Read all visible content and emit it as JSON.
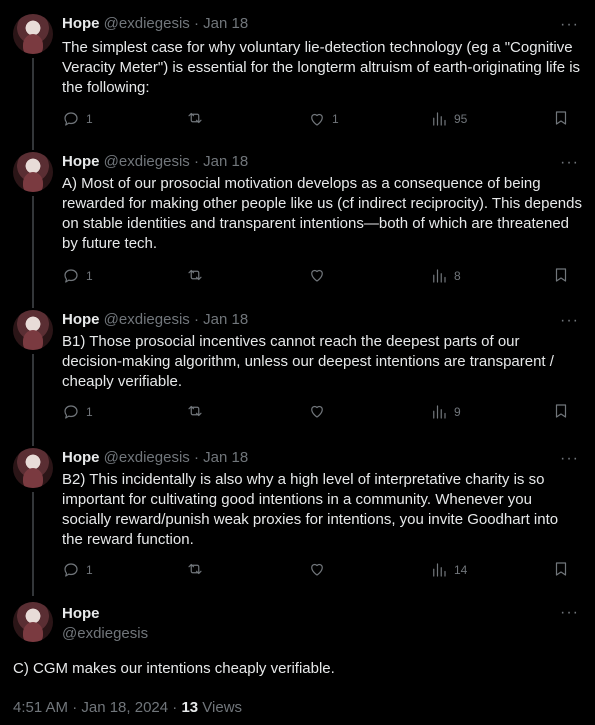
{
  "author": {
    "name": "Hope",
    "handle": "@exdiegesis"
  },
  "more_label": "···",
  "tweets": [
    {
      "date": "Jan 18",
      "text": "The simplest case for why voluntary lie-detection technology (eg a \"Cognitive Veracity Meter\") is essential for the longterm altruism of earth-originating life is the following:",
      "replies": "1",
      "retweets": "",
      "likes": "1",
      "views": "95"
    },
    {
      "date": "Jan 18",
      "text": "A) Most of our prosocial motivation develops as a consequence of being rewarded for making other people like us (cf indirect reciprocity). This depends on stable identities and transparent intentions—both of which are threatened by future tech.",
      "replies": "1",
      "retweets": "",
      "likes": "",
      "views": "8"
    },
    {
      "date": "Jan 18",
      "text": "B1) Those prosocial incentives cannot reach the deepest parts of our decision-making algorithm, unless our deepest intentions are transparent / cheaply verifiable.",
      "replies": "1",
      "retweets": "",
      "likes": "",
      "views": "9"
    },
    {
      "date": "Jan 18",
      "text": "B2) This incidentally is also why a high level of interpretative charity is so important for cultivating good intentions in a community. Whenever you socially reward/punish weak proxies for intentions, you invite Goodhart into the reward function.",
      "replies": "1",
      "retweets": "",
      "likes": "",
      "views": "14"
    }
  ],
  "main_tweet": {
    "text": "C) CGM makes our intentions cheaply verifiable.",
    "time": "4:51 AM · Jan 18, 2024 · ",
    "views_count": "13",
    "views_label": " Views"
  },
  "icons": {
    "reply": "reply-icon",
    "retweet": "retweet-icon",
    "like": "heart-icon",
    "views": "views-chart-icon",
    "bookmark": "bookmark-icon",
    "more": "more-dots-icon"
  },
  "colors": {
    "background": "#000000",
    "text": "#e7e9ea",
    "muted": "#71767b",
    "thread_line": "#333639"
  }
}
